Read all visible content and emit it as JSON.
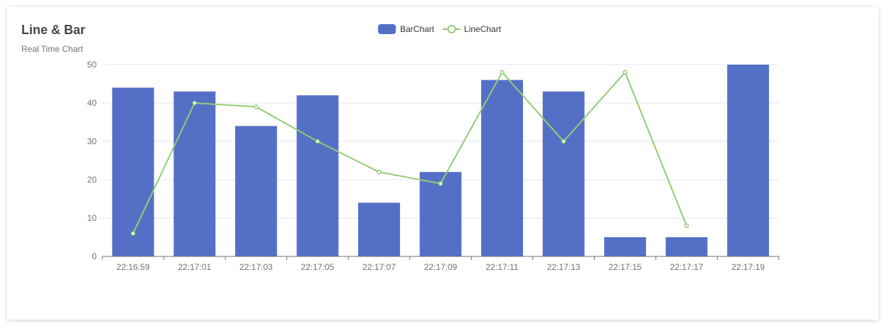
{
  "title": "Line & Bar",
  "subtitle": "Real Time Chart",
  "legend": {
    "bar_label": "BarChart",
    "line_label": "LineChart"
  },
  "colors": {
    "bar": "#5470c6",
    "line": "#91cc75",
    "axis": "#6e7079",
    "grid": "#e0e6f1"
  },
  "chart_data": {
    "type": "bar",
    "categories": [
      "22:16:59",
      "22:17:01",
      "22:17:03",
      "22:17:05",
      "22:17:07",
      "22:17:09",
      "22:17:11",
      "22:17:13",
      "22:17:15",
      "22:17:17",
      "22:17:19"
    ],
    "series": [
      {
        "name": "BarChart",
        "type": "bar",
        "values": [
          44,
          43,
          34,
          42,
          14,
          22,
          46,
          43,
          5,
          5,
          50
        ]
      },
      {
        "name": "LineChart",
        "type": "line",
        "values": [
          6,
          40,
          39,
          30,
          22,
          19,
          48,
          30,
          48,
          8,
          null
        ]
      }
    ],
    "ylim": [
      0,
      50
    ],
    "yticks": [
      0,
      10,
      20,
      30,
      40,
      50
    ],
    "grid": true,
    "legend_position": "top-center"
  }
}
